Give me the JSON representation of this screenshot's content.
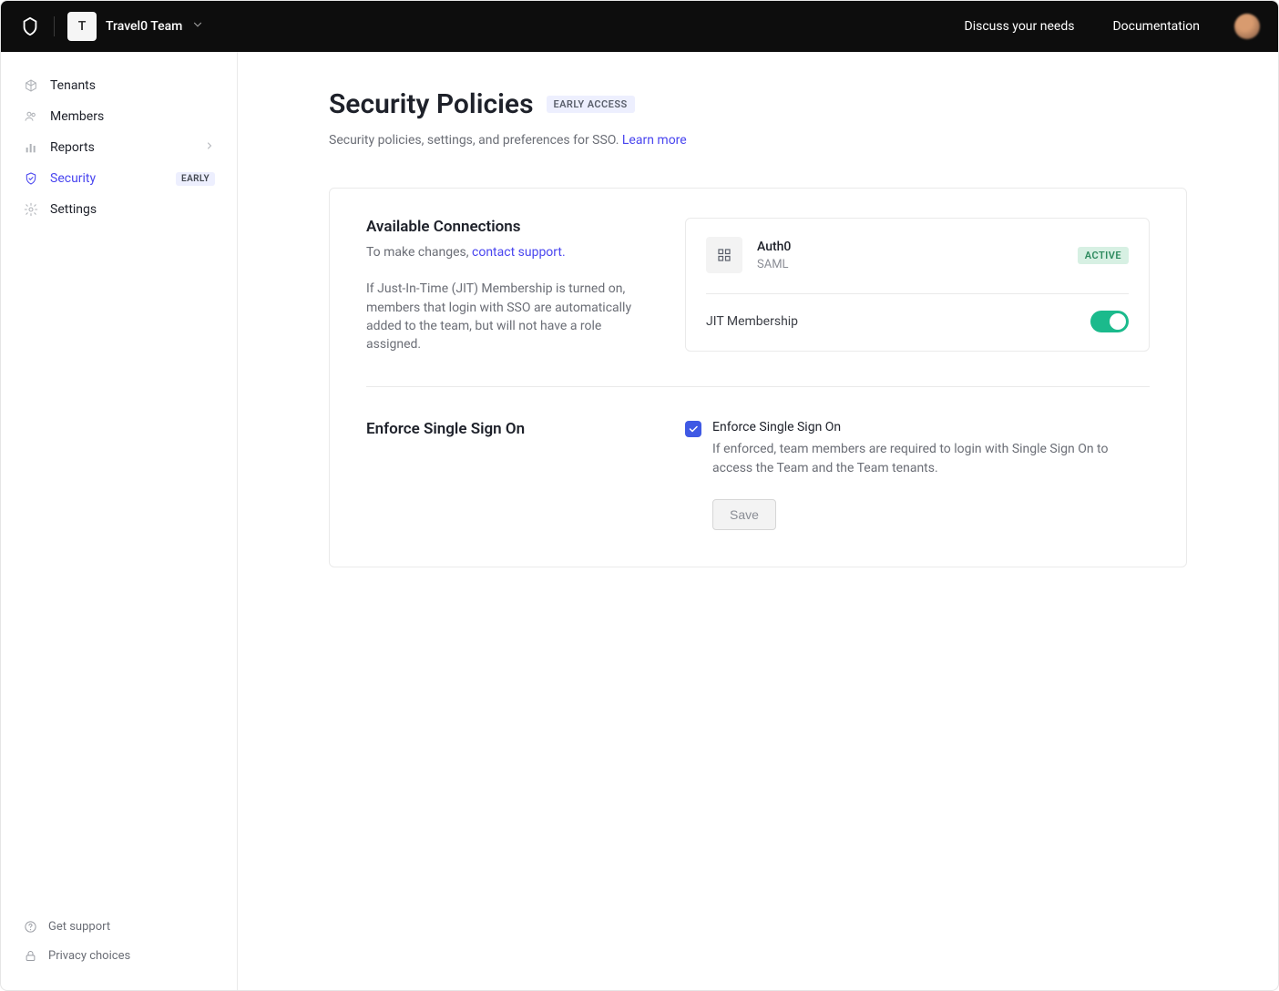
{
  "header": {
    "team_initial": "T",
    "team_name": "Travel0 Team",
    "discuss_label": "Discuss your needs",
    "docs_label": "Documentation"
  },
  "sidebar": {
    "items": [
      {
        "label": "Tenants"
      },
      {
        "label": "Members"
      },
      {
        "label": "Reports"
      },
      {
        "label": "Security",
        "badge": "EARLY"
      },
      {
        "label": "Settings"
      }
    ],
    "footer": {
      "support": "Get support",
      "privacy": "Privacy choices"
    }
  },
  "page": {
    "title": "Security Policies",
    "badge": "EARLY ACCESS",
    "subtitle_prefix": "Security policies, settings, and preferences for SSO. ",
    "learn_more": "Learn more"
  },
  "connections": {
    "heading": "Available Connections",
    "change_prefix": "To make changes, ",
    "contact_link": "contact support.",
    "jit_description": "If Just-In-Time (JIT) Membership is turned on, members that login with SSO are automatically added to the team, but will not have a role assigned.",
    "item": {
      "name": "Auth0",
      "protocol": "SAML",
      "status": "ACTIVE"
    },
    "jit_label": "JIT Membership",
    "jit_enabled": true
  },
  "enforce": {
    "heading": "Enforce Single Sign On",
    "checkbox_label": "Enforce Single Sign On",
    "checkbox_checked": true,
    "description": "If enforced, team members are required to login with Single Sign On to access the Team and the Team tenants.",
    "save_label": "Save"
  }
}
